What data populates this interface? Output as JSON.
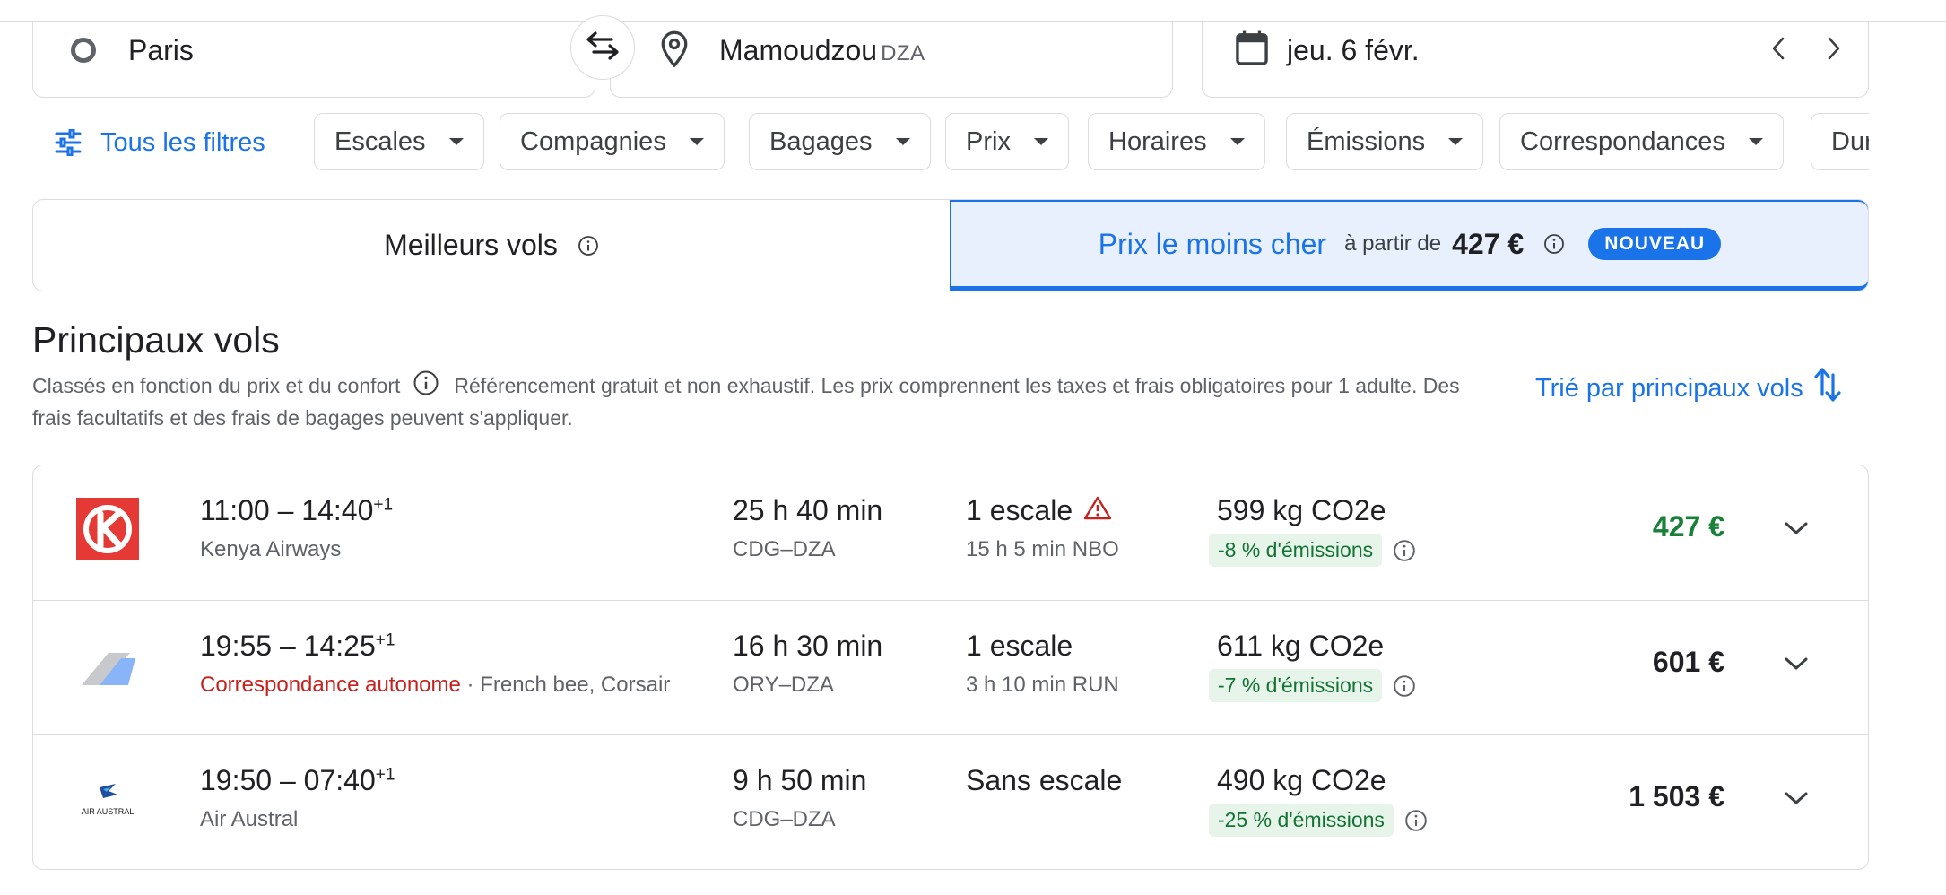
{
  "search": {
    "origin": "Paris",
    "destination": "Mamoudzou",
    "destination_code": "DZA",
    "date": "jeu. 6 févr."
  },
  "filters": {
    "all_label": "Tous les filtres",
    "chips": [
      "Escales",
      "Compagnies",
      "Bagages",
      "Prix",
      "Horaires",
      "Émissions",
      "Correspondances",
      "Durée"
    ]
  },
  "tabs": {
    "best": "Meilleurs vols",
    "cheapest": "Prix le moins cher",
    "from_label": "à partir de",
    "from_price": "427 €",
    "new_badge": "NOUVEAU"
  },
  "section": {
    "title": "Principaux vols",
    "ranking_note": "Classés en fonction du prix et du confort",
    "disclaimer": "Référencement gratuit et non exhaustif. Les prix comprennent les taxes et frais obligatoires pour 1 adulte. Des frais facultatifs et des frais de bagages peuvent s'appliquer.",
    "sort_label": "Trié par principaux vols"
  },
  "flights": [
    {
      "time": "11:00 – 14:40",
      "day_offset": "+1",
      "airline": "Kenya Airways",
      "self_transfer": "",
      "duration": "25 h 40 min",
      "route": "CDG–DZA",
      "stops": "1 escale",
      "layover": "15 h 5 min NBO",
      "co2": "599 kg CO2e",
      "emissions": "-8 % d'émissions",
      "price": "427 €",
      "price_color": "#188038",
      "logo": "kenya-airways-logo"
    },
    {
      "time": "19:55 – 14:25",
      "day_offset": "+1",
      "airline": "French bee, Corsair",
      "self_transfer": "Correspondance autonome",
      "duration": "16 h 30 min",
      "route": "ORY–DZA",
      "stops": "1 escale",
      "layover": "3 h 10 min RUN",
      "co2": "611 kg CO2e",
      "emissions": "-7 % d'émissions",
      "price": "601 €",
      "price_color": "#202124",
      "logo": "multi-airline-logo"
    },
    {
      "time": "19:50 – 07:40",
      "day_offset": "+1",
      "airline": "Air Austral",
      "self_transfer": "",
      "duration": "9 h 50 min",
      "route": "CDG–DZA",
      "stops": "Sans escale",
      "layover": "",
      "co2": "490 kg CO2e",
      "emissions": "-25 % d'émissions",
      "price": "1 503 €",
      "price_color": "#202124",
      "logo": "air-austral-logo",
      "logo_text": "AIR AUSTRAL"
    }
  ],
  "colors": {
    "accent": "#1a73e8",
    "selected_tab_bg": "#e8f0fe",
    "emissions_bg": "#e6f4ea",
    "emissions_text": "#137333",
    "warning": "#c5221f"
  }
}
